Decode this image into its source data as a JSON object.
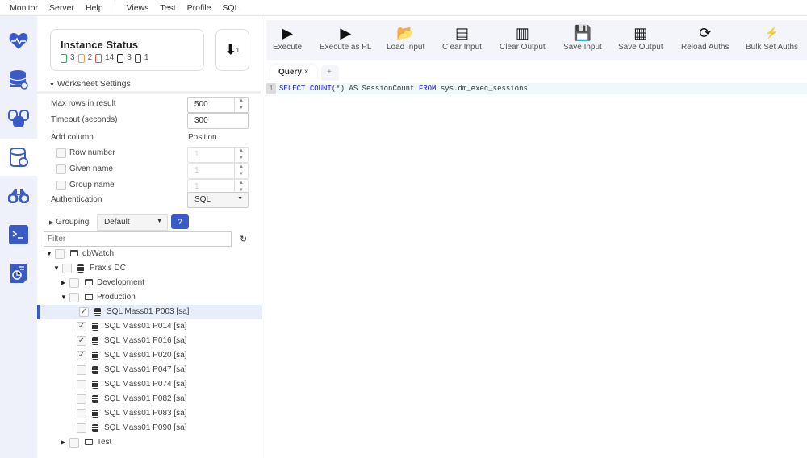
{
  "menu": [
    "Monitor",
    "Server",
    "Help",
    "Views",
    "Test",
    "Profile",
    "SQL"
  ],
  "rail": [
    "heart-pulse-icon",
    "database-settings-icon",
    "database-group-icon",
    "database-query-icon",
    "binoculars-icon",
    "terminal-icon",
    "report-icon"
  ],
  "status": {
    "title": "Instance Status",
    "counts": [
      {
        "color": "#2eaa5c",
        "value": "3"
      },
      {
        "color": "#e8a23a",
        "value": "2"
      },
      {
        "color": "#d9534f",
        "value": "14"
      },
      {
        "color": "#222",
        "value": "3"
      },
      {
        "color": "#444",
        "value": "1"
      }
    ],
    "download_count": "1"
  },
  "settings": {
    "title": "Worksheet Settings",
    "max_rows_label": "Max rows in result",
    "max_rows": "500",
    "timeout_label": "Timeout (seconds)",
    "timeout": "300",
    "add_column_label": "Add column",
    "position_label": "Position",
    "columns": [
      {
        "label": "Row number",
        "pos": "1"
      },
      {
        "label": "Given name",
        "pos": "1"
      },
      {
        "label": "Group name",
        "pos": "1"
      }
    ],
    "auth_label": "Authentication",
    "auth": "SQL"
  },
  "grouping": {
    "label": "Grouping",
    "value": "Default",
    "help": "?"
  },
  "filter": {
    "placeholder": "Filter"
  },
  "tree": [
    {
      "label": "dbWatch",
      "level": 0,
      "type": "folder",
      "expand": "open",
      "checked": false
    },
    {
      "label": "Praxis DC",
      "level": 1,
      "type": "server",
      "expand": "open",
      "checked": false
    },
    {
      "label": "Development",
      "level": 2,
      "type": "folder",
      "expand": "closed",
      "checked": false
    },
    {
      "label": "Production",
      "level": 2,
      "type": "folder",
      "expand": "open",
      "checked": false
    },
    {
      "label": "SQL Mass01 P003 [sa]",
      "level": 3,
      "type": "db",
      "checked": true,
      "selected": true
    },
    {
      "label": "SQL Mass01 P014 [sa]",
      "level": 3,
      "type": "db",
      "checked": true
    },
    {
      "label": "SQL Mass01 P016 [sa]",
      "level": 3,
      "type": "db",
      "checked": true
    },
    {
      "label": "SQL Mass01 P020 [sa]",
      "level": 3,
      "type": "db",
      "checked": true
    },
    {
      "label": "SQL Mass01 P047 [sa]",
      "level": 3,
      "type": "db",
      "checked": false
    },
    {
      "label": "SQL Mass01 P074 [sa]",
      "level": 3,
      "type": "db",
      "checked": false
    },
    {
      "label": "SQL Mass01 P082 [sa]",
      "level": 3,
      "type": "db",
      "checked": false
    },
    {
      "label": "SQL Mass01 P083 [sa]",
      "level": 3,
      "type": "db",
      "checked": false
    },
    {
      "label": "SQL Mass01 P090 [sa]",
      "level": 3,
      "type": "db",
      "checked": false
    },
    {
      "label": "Test",
      "level": 2,
      "type": "folder",
      "expand": "closed",
      "checked": false
    }
  ],
  "toolbar": [
    {
      "label": "Execute",
      "icon": "play-icon"
    },
    {
      "label": "Execute as PL",
      "icon": "play-icon"
    },
    {
      "label": "Load Input",
      "icon": "folder-open-icon"
    },
    {
      "label": "Clear Input",
      "icon": "clear-input-icon"
    },
    {
      "label": "Clear Output",
      "icon": "clear-output-icon"
    },
    {
      "label": "Save Input",
      "icon": "save-icon"
    },
    {
      "label": "Save Output",
      "icon": "save-output-icon"
    },
    {
      "label": "Reload Auths",
      "icon": "reload-icon"
    },
    {
      "label": "Bulk Set Auths",
      "icon": "lightning-icon"
    }
  ],
  "tabs": {
    "active": "Query",
    "close": "×",
    "add": "+"
  },
  "editor": {
    "line": "1",
    "kw1": "SELECT",
    "fn": "COUNT",
    "t1": "(*) AS SessionCount ",
    "kw2": "FROM",
    "t2": " sys.dm_exec_sessions"
  }
}
